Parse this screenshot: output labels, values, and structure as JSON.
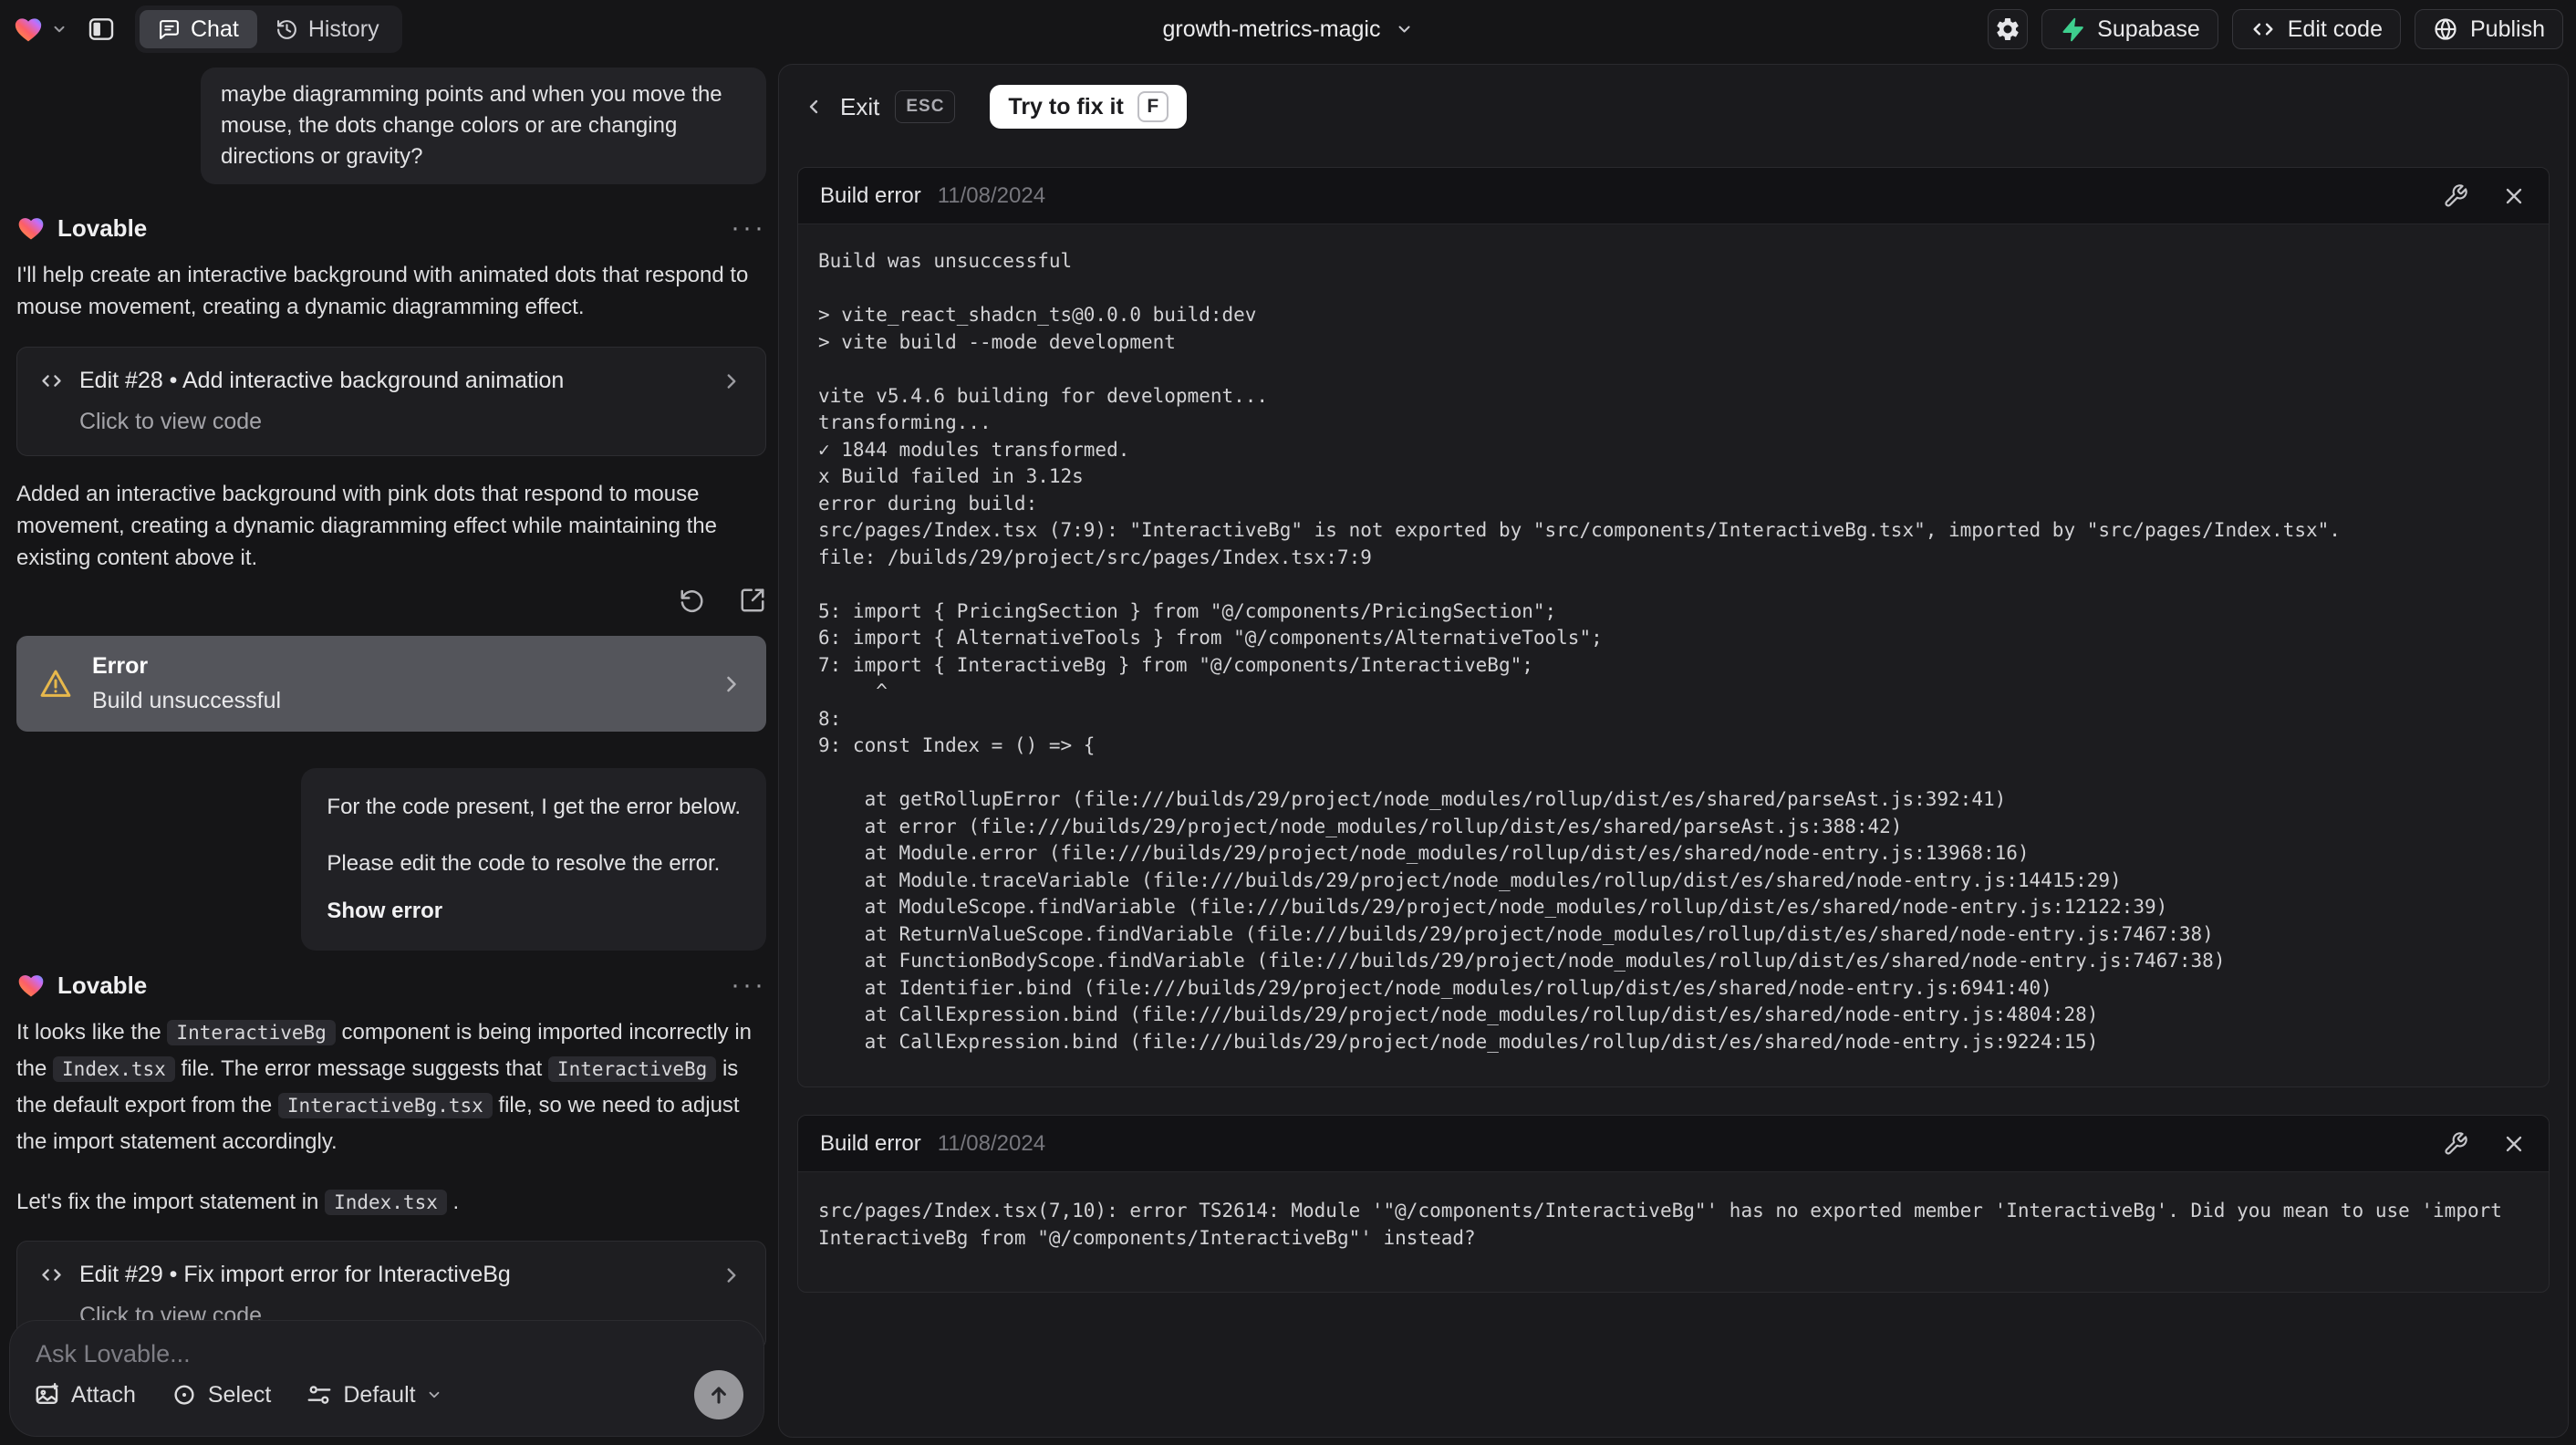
{
  "colors": {
    "supabase_green": "#3ECF8E",
    "warning_amber": "#E7B84C",
    "fix_button_bg": "#FFFFFF",
    "send_button_bg": "#97979B",
    "error_banner_bg": "#54555B"
  },
  "icons": {
    "logo": "lovable-heart",
    "sidebar": "panel-left",
    "chat_tab": "message-square",
    "history_tab": "history-clock",
    "settings": "gear",
    "supabase": "supabase-bolt",
    "edit_code": "code-brackets",
    "publish": "globe",
    "more": "···",
    "retry": "rotate-ccw",
    "open_preview": "external-link-square",
    "warning": "warning-triangle",
    "chevron_right": "chevron-right",
    "wrench": "wrench",
    "close": "x",
    "attach": "image",
    "select": "focus-circle",
    "model": "sliders",
    "send": "arrow-up"
  },
  "topbar": {
    "tab_chat": "Chat",
    "tab_history": "History",
    "project_title": "growth-metrics-magic",
    "btn_supabase": "Supabase",
    "btn_edit_code": "Edit code",
    "btn_publish": "Publish"
  },
  "fixbar": {
    "exit_label": "Exit",
    "esc_key": "ESC",
    "fix_label": "Try to fix it",
    "fix_key": "F"
  },
  "chat": {
    "user_message_1": "maybe diagramming points and when you move the mouse, the dots change colors or are changing directions or gravity?",
    "assistant_1": {
      "sender": "Lovable",
      "more": "···",
      "intro": "I'll help create an interactive background with animated dots that respond to mouse movement, creating a dynamic diagramming effect.",
      "edit_card": {
        "title": "Edit #28 • Add interactive background animation",
        "subtitle": "Click to view code"
      },
      "summary": "Added an interactive background with pink dots that respond to mouse movement, creating a dynamic diagramming effect while maintaining the existing content above it.",
      "error_banner": {
        "title": "Error",
        "subtitle": "Build unsuccessful"
      }
    },
    "user_message_2": {
      "para1": "For the code present, I get the error below.",
      "para2": "Please edit the code to resolve the error.",
      "link": "Show error"
    },
    "assistant_2": {
      "sender": "Lovable",
      "more": "···",
      "para1": [
        {
          "v": "It looks like the "
        },
        {
          "v": "InteractiveBg",
          "code": true
        },
        {
          "v": " component is being imported incorrectly in the "
        },
        {
          "v": "Index.tsx",
          "code": true
        },
        {
          "v": " file. The error message suggests that "
        },
        {
          "v": "InteractiveBg",
          "code": true
        },
        {
          "v": " is the default export from the "
        },
        {
          "v": "InteractiveBg.tsx",
          "code": true
        },
        {
          "v": " file, so we need to adjust the import statement accordingly."
        }
      ],
      "para2": [
        {
          "v": "Let's fix the import statement in "
        },
        {
          "v": "Index.tsx",
          "code": true
        },
        {
          "v": " ."
        }
      ],
      "edit_card": {
        "title": "Edit #29 • Fix import error for InteractiveBg",
        "subtitle": "Click to view code"
      }
    },
    "composer": {
      "placeholder": "Ask Lovable...",
      "attach": "Attach",
      "select": "Select",
      "model": "Default"
    }
  },
  "errors": [
    {
      "title": "Build error",
      "date": "11/08/2024",
      "log_lines": [
        "Build was unsuccessful",
        "",
        "> vite_react_shadcn_ts@0.0.0 build:dev",
        "> vite build --mode development",
        "",
        "vite v5.4.6 building for development...",
        "transforming...",
        "✓ 1844 modules transformed.",
        "x Build failed in 3.12s",
        "error during build:",
        "src/pages/Index.tsx (7:9): \"InteractiveBg\" is not exported by \"src/components/InteractiveBg.tsx\", imported by \"src/pages/Index.tsx\".",
        "file: /builds/29/project/src/pages/Index.tsx:7:9",
        "",
        "5: import { PricingSection } from \"@/components/PricingSection\";",
        "6: import { AlternativeTools } from \"@/components/AlternativeTools\";",
        "7: import { InteractiveBg } from \"@/components/InteractiveBg\";",
        "     ^",
        "8: ",
        "9: const Index = () => {",
        "",
        "    at getRollupError (file:///builds/29/project/node_modules/rollup/dist/es/shared/parseAst.js:392:41)",
        "    at error (file:///builds/29/project/node_modules/rollup/dist/es/shared/parseAst.js:388:42)",
        "    at Module.error (file:///builds/29/project/node_modules/rollup/dist/es/shared/node-entry.js:13968:16)",
        "    at Module.traceVariable (file:///builds/29/project/node_modules/rollup/dist/es/shared/node-entry.js:14415:29)",
        "    at ModuleScope.findVariable (file:///builds/29/project/node_modules/rollup/dist/es/shared/node-entry.js:12122:39)",
        "    at ReturnValueScope.findVariable (file:///builds/29/project/node_modules/rollup/dist/es/shared/node-entry.js:7467:38)",
        "    at FunctionBodyScope.findVariable (file:///builds/29/project/node_modules/rollup/dist/es/shared/node-entry.js:7467:38)",
        "    at Identifier.bind (file:///builds/29/project/node_modules/rollup/dist/es/shared/node-entry.js:6941:40)",
        "    at CallExpression.bind (file:///builds/29/project/node_modules/rollup/dist/es/shared/node-entry.js:4804:28)",
        "    at CallExpression.bind (file:///builds/29/project/node_modules/rollup/dist/es/shared/node-entry.js:9224:15)"
      ]
    },
    {
      "title": "Build error",
      "date": "11/08/2024",
      "log_lines": [
        "src/pages/Index.tsx(7,10): error TS2614: Module '\"@/components/InteractiveBg\"' has no exported member 'InteractiveBg'. Did you mean to use 'import InteractiveBg from \"@/components/InteractiveBg\"' instead?"
      ]
    }
  ]
}
